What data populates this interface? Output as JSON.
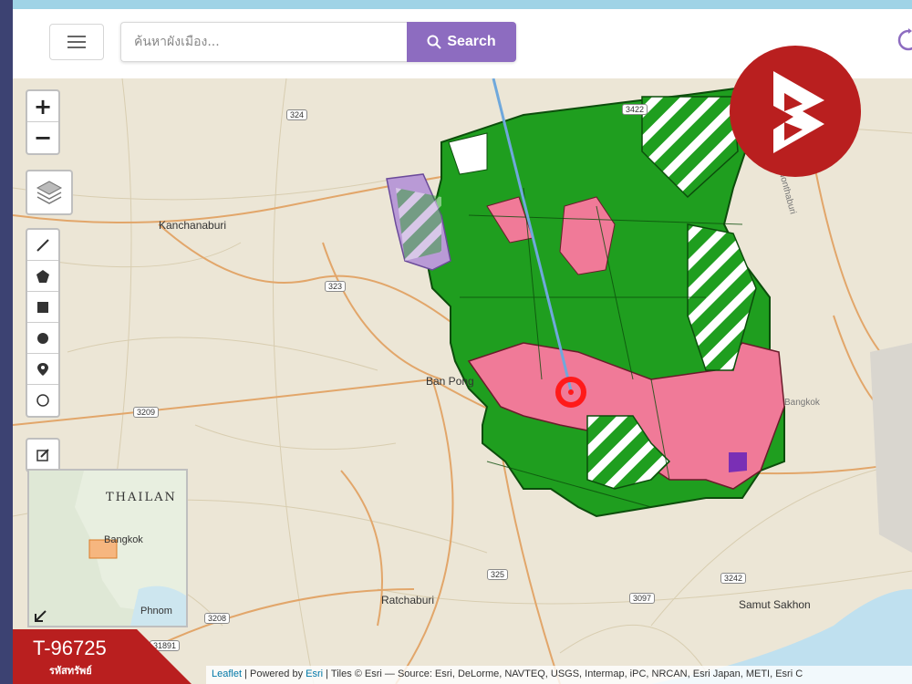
{
  "header": {
    "search_placeholder": "ค้นหาผังเมือง...",
    "search_button_label": "Search"
  },
  "map": {
    "cities": {
      "kanchanaburi": "Kanchanaburi",
      "ban_pong": "Ban Pong",
      "ratchaburi": "Ratchaburi",
      "samut_sakhon": "Samut Sakhon",
      "bangkok": "Bangkok",
      "nonthaburi": "Nonthaburi"
    },
    "route_shields": [
      "324",
      "3422",
      "323",
      "3209",
      "325",
      "3097",
      "3242",
      "3208",
      "31891"
    ],
    "zone_colors": {
      "agricultural": "#1f9e1f",
      "residential": "#f07a98",
      "conservation": "#1f9e1f",
      "special": "#b99ad6",
      "industrial": "#7a2fb5"
    }
  },
  "minimap": {
    "country_label": "THAILAN",
    "city_label": "Bangkok",
    "city2_label": "Phnom"
  },
  "badge": {
    "code": "T-96725",
    "caption": "รหัสทรัพย์"
  },
  "attribution": {
    "leaflet": "Leaflet",
    "powered_by": " | Powered by ",
    "esri": "Esri",
    "tiles_text": " | Tiles © Esri — Source: Esri, DeLorme, NAVTEQ, USGS, Intermap, iPC, NRCAN, Esri Japan, METI, Esri C"
  }
}
